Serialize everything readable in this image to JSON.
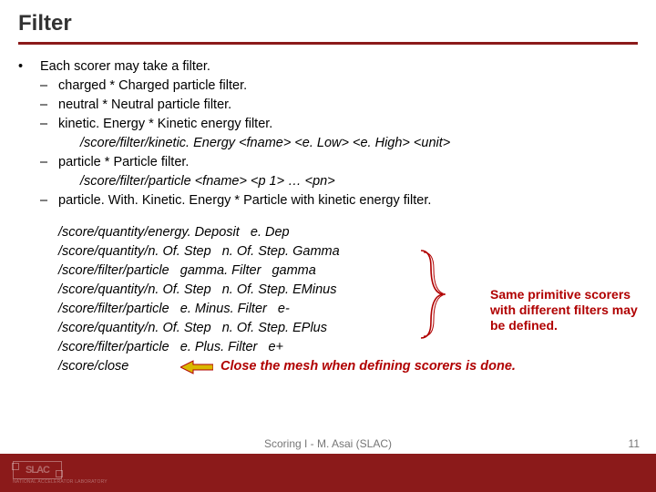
{
  "title": "Filter",
  "bullet_symbol": "•",
  "dash_symbol": "–",
  "main_bullet": "Each scorer may take a filter.",
  "dashes": [
    {
      "label": "charged * Charged particle filter."
    },
    {
      "label": "neutral * Neutral particle filter."
    },
    {
      "label": "kinetic. Energy * Kinetic energy filter.",
      "cmd": "/score/filter/kinetic. Energy <fname> <e. Low> <e. High> <unit>"
    },
    {
      "label": "particle * Particle filter.",
      "cmd": "/score/filter/particle <fname> <p 1> … <pn>"
    },
    {
      "label": "particle. With. Kinetic. Energy * Particle with kinetic energy filter."
    }
  ],
  "example": {
    "lines": [
      "/score/quantity/energy. Deposit   e. Dep",
      "/score/quantity/n. Of. Step   n. Of. Step. Gamma",
      "/score/filter/particle   gamma. Filter   gamma",
      "/score/quantity/n. Of. Step   n. Of. Step. EMinus",
      "/score/filter/particle   e. Minus. Filter   e-",
      "/score/quantity/n. Of. Step   n. Of. Step. EPlus",
      "/score/filter/particle   e. Plus. Filter   e+"
    ],
    "close_line": "/score/close"
  },
  "annotation_brace": "Same primitive scorers with different filters may be defined.",
  "annotation_close": "Close the mesh when defining scorers is done.",
  "footer": {
    "logo_text": "SLAC",
    "lab_text": "NATIONAL ACCELERATOR LABORATORY",
    "center": "Scoring I - M. Asai (SLAC)",
    "page": "11"
  }
}
